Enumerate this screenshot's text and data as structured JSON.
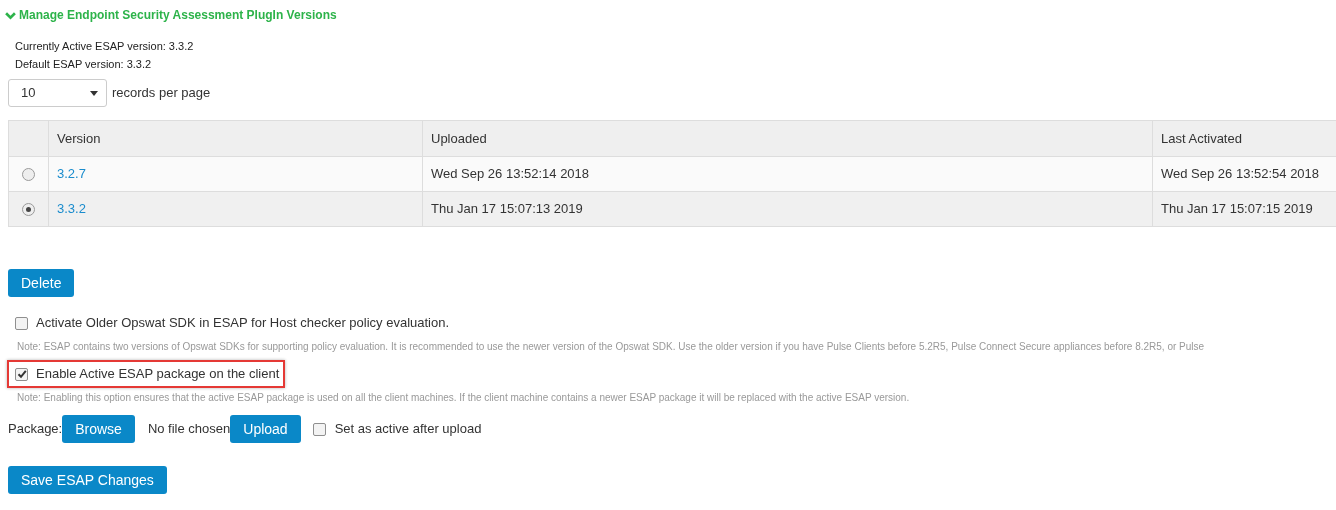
{
  "section": {
    "title": "Manage Endpoint Security Assessment PlugIn Versions",
    "expanded": true
  },
  "info": [
    "Currently Active ESAP version: 3.3.2",
    "Default ESAP version: 3.3.2"
  ],
  "page_size": {
    "value": "10",
    "label": "records per page"
  },
  "table": {
    "columns": [
      "Version",
      "Uploaded",
      "Last Activated"
    ],
    "rows": [
      {
        "selected": false,
        "version": "3.2.7",
        "uploaded": "Wed Sep 26 13:52:14 2018",
        "last_activated": "Wed Sep 26 13:52:54 2018"
      },
      {
        "selected": true,
        "version": "3.3.2",
        "uploaded": "Thu Jan 17 15:07:13 2019",
        "last_activated": "Thu Jan 17 15:07:15 2019"
      }
    ]
  },
  "delete_button": "Delete",
  "options": [
    {
      "label": "Activate Older Opswat SDK in ESAP for Host checker policy evaluation.",
      "checked": false,
      "highlighted": false,
      "note": "Note: ESAP contains two versions of Opswat SDKs for supporting policy evaluation. It is recommended to use the newer version of the Opswat SDK. Use the older version if you have Pulse Clients before 5.2R5, Pulse Connect Secure appliances before 8.2R5, or Pulse"
    },
    {
      "label": "Enable Active ESAP package on the client",
      "checked": true,
      "highlighted": true,
      "note": "Note: Enabling this option ensures that the active ESAP package is used on all the client machines. If the client machine contains a newer ESAP package it will be replaced with the active ESAP version."
    }
  ],
  "package": {
    "label": "Package:",
    "browse": "Browse",
    "file_status": "No file chosen",
    "upload": "Upload",
    "set_active": {
      "label": "Set as active after upload",
      "checked": false
    }
  },
  "save_button": "Save ESAP Changes"
}
